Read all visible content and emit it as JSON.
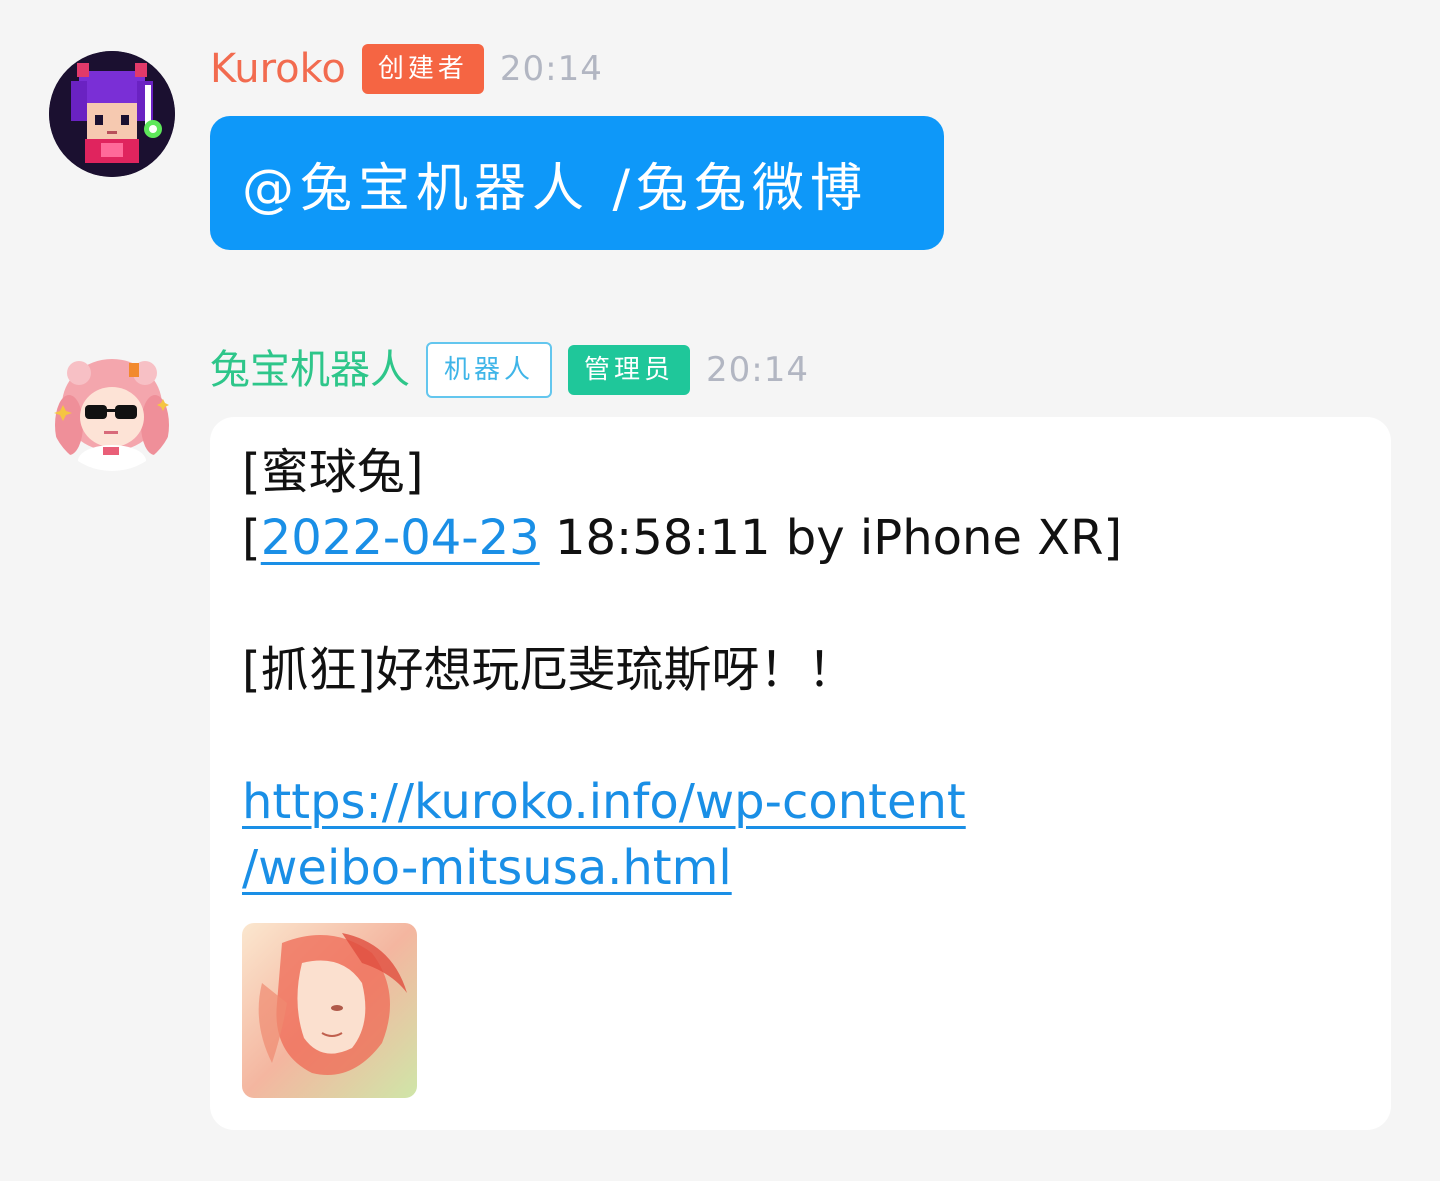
{
  "colors": {
    "page_bg": "#f5f5f5",
    "creator_name": "#f26b4f",
    "creator_badge": "#f56543",
    "bot_name": "#2ec68a",
    "bot_badge_border": "#63c6ee",
    "bot_badge_text": "#3fb5e8",
    "admin_badge": "#1fc79a",
    "blue_bubble": "#0e98f9",
    "link": "#1a8fe6"
  },
  "messages": [
    {
      "sender": "Kuroko",
      "badges": [
        "创建者"
      ],
      "time": "20:14",
      "text": "@兔宝机器人 /兔兔微博"
    },
    {
      "sender": "兔宝机器人",
      "badges": [
        "机器人",
        "管理员"
      ],
      "time": "20:14",
      "content": {
        "line1": "[蜜球兔]",
        "date_open": "[",
        "date_link": "2022-04-23",
        "date_rest": " 18:58:11 by iPhone XR]",
        "body": "[抓狂]好想玩厄斐琉斯呀！！",
        "url_part1": "https://kuroko.info/wp-content",
        "url_part2": "/weibo-mitsusa.html"
      },
      "image_icon": "anime-art-thumbnail"
    }
  ]
}
